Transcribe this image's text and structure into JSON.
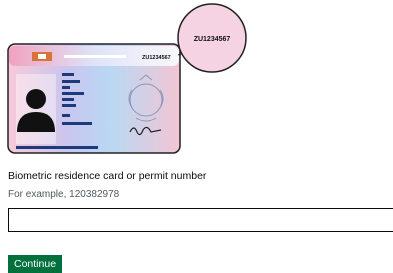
{
  "card": {
    "number": "ZU1234567",
    "magnified_number": "ZU1234567"
  },
  "form": {
    "label": "Biometric residence card or permit number",
    "hint": "For example, 120382978",
    "input_value": "",
    "continue_label": "Continue"
  },
  "colors": {
    "button_green": "#00703c",
    "text": "#0b0c0c",
    "hint": "#505a5f"
  }
}
